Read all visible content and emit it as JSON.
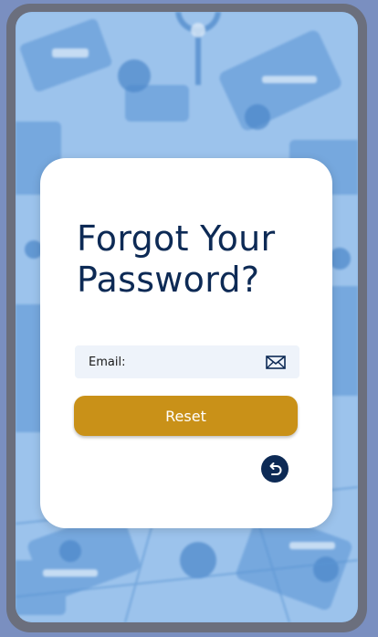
{
  "page": {
    "title": "Forgot Your Password?"
  },
  "form": {
    "email_label": "Email:",
    "email_value": "",
    "email_icon": "envelope-icon",
    "reset_label": "Reset",
    "back_icon": "undo-arrow-icon"
  },
  "colors": {
    "background": "#8fb8e6",
    "title": "#0d2a55",
    "button": "#c99118",
    "field": "#eef3fa",
    "back_button": "#0d2a55"
  }
}
